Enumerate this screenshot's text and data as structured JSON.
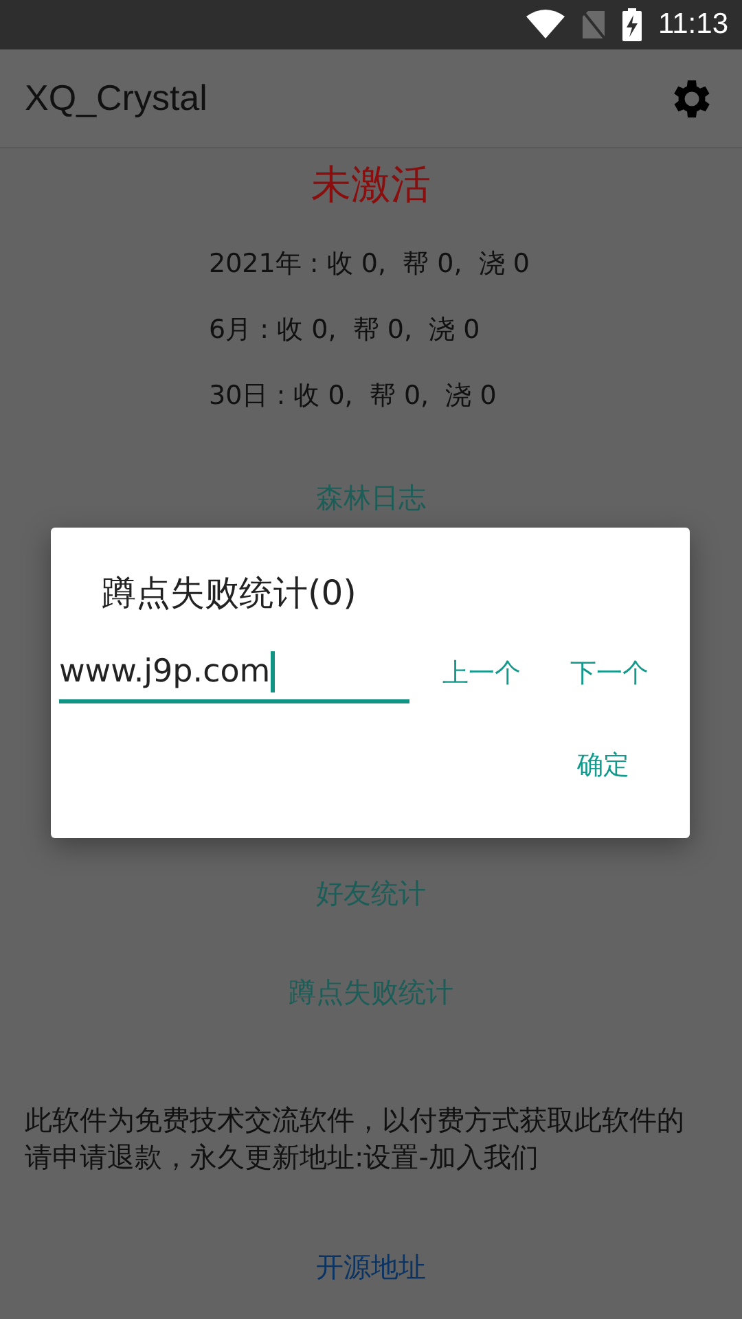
{
  "status_bar": {
    "time": "11:13"
  },
  "app_bar": {
    "title": "XQ_Crystal"
  },
  "activation": {
    "text": "未激活"
  },
  "stats": [
    "2021年 : 收 0,  帮 0,  浇 0",
    "6月 : 收 0,  帮 0,  浇 0",
    "30日 : 收 0,  帮 0,  浇 0"
  ],
  "links_top": [
    {
      "label": "森林日志",
      "kind": "action"
    }
  ],
  "links_bottom": [
    {
      "label": "好友统计",
      "kind": "action"
    },
    {
      "label": "蹲点失败统计",
      "kind": "action"
    }
  ],
  "notice": "此软件为免费技术交流软件，以付费方式获取此软件的请申请退款，永久更新地址:设置-加入我们",
  "footer_link": {
    "label": "开源地址",
    "kind": "url"
  },
  "dialog": {
    "title": "蹲点失败统计(0)",
    "input": {
      "value": "www.j9p.com"
    },
    "buttons": [
      "上一个",
      "下一个"
    ],
    "confirm": "确定"
  }
}
